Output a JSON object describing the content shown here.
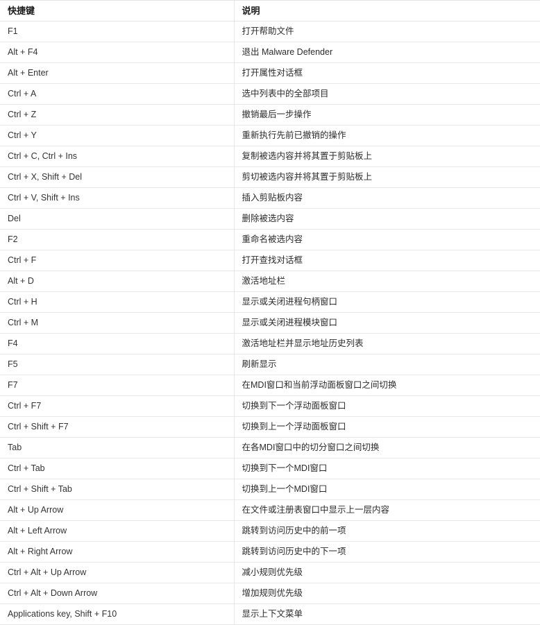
{
  "table": {
    "columns": [
      {
        "id": "key",
        "label": "快捷键"
      },
      {
        "id": "description",
        "label": "说明"
      }
    ],
    "rows": [
      {
        "key": "F1",
        "description": "打开帮助文件"
      },
      {
        "key": "Alt + F4",
        "description": "退出 Malware Defender"
      },
      {
        "key": "Alt + Enter",
        "description": "打开属性对话框"
      },
      {
        "key": "Ctrl + A",
        "description": "选中列表中的全部项目"
      },
      {
        "key": "Ctrl + Z",
        "description": "撤销最后一步操作"
      },
      {
        "key": "Ctrl + Y",
        "description": "重新执行先前已撤销的操作"
      },
      {
        "key": "Ctrl + C, Ctrl + Ins",
        "description": "复制被选内容并将其置于剪贴板上"
      },
      {
        "key": "Ctrl + X, Shift + Del",
        "description": "剪切被选内容并将其置于剪贴板上"
      },
      {
        "key": "Ctrl + V, Shift + Ins",
        "description": "插入剪贴板内容"
      },
      {
        "key": "Del",
        "description": "删除被选内容"
      },
      {
        "key": "F2",
        "description": "重命名被选内容"
      },
      {
        "key": "Ctrl + F",
        "description": "打开查找对话框"
      },
      {
        "key": "Alt + D",
        "description": "激活地址栏"
      },
      {
        "key": "Ctrl + H",
        "description": "显示或关闭进程句柄窗口"
      },
      {
        "key": "Ctrl + M",
        "description": "显示或关闭进程模块窗口"
      },
      {
        "key": "F4",
        "description": "激活地址栏并显示地址历史列表"
      },
      {
        "key": "F5",
        "description": "刷新显示"
      },
      {
        "key": "F7",
        "description": "在MDI窗口和当前浮动面板窗口之间切换"
      },
      {
        "key": "Ctrl + F7",
        "description": "切换到下一个浮动面板窗口"
      },
      {
        "key": "Ctrl + Shift + F7",
        "description": "切换到上一个浮动面板窗口"
      },
      {
        "key": "Tab",
        "description": "在各MDI窗口中的切分窗口之间切换"
      },
      {
        "key": "Ctrl + Tab",
        "description": "切换到下一个MDI窗口"
      },
      {
        "key": "Ctrl + Shift + Tab",
        "description": "切换到上一个MDI窗口"
      },
      {
        "key": "Alt + Up Arrow",
        "description": "在文件或注册表窗口中显示上一层内容"
      },
      {
        "key": "Alt + Left Arrow",
        "description": "跳转到访问历史中的前一项"
      },
      {
        "key": "Alt + Right Arrow",
        "description": "跳转到访问历史中的下一项"
      },
      {
        "key": "Ctrl + Alt + Up Arrow",
        "description": "减小规则优先级"
      },
      {
        "key": "Ctrl + Alt + Down Arrow",
        "description": "增加规则优先级"
      },
      {
        "key": "Applications key, Shift + F10",
        "description": "显示上下文菜单"
      }
    ]
  }
}
